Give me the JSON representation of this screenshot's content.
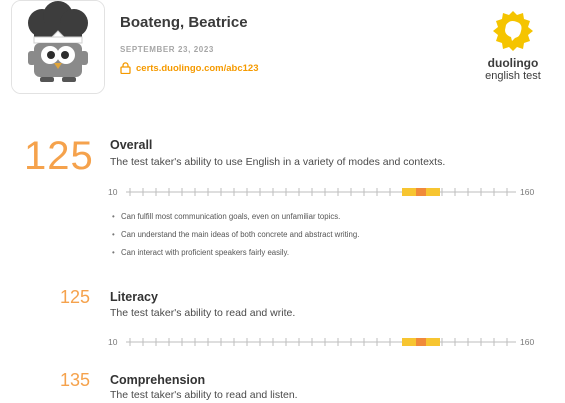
{
  "header": {
    "name": "Boateng, Beatrice",
    "date": "SEPTEMBER 23, 2023",
    "cert_link": "certs.duolingo.com/abc123",
    "brand_word": "duolingo",
    "brand_sub": "english test"
  },
  "overall": {
    "score": "125",
    "title": "Overall",
    "description": "The test taker's ability to use English in a variety of modes and contexts.",
    "scale_min": "10",
    "scale_max": "160",
    "bullets": [
      "Can fulfill most communication goals, even on unfamiliar topics.",
      "Can understand the main ideas of both concrete and abstract writing.",
      "Can interact with proficient speakers fairly easily."
    ]
  },
  "literacy": {
    "score": "125",
    "title": "Literacy",
    "description": "The test taker's ability to read and write.",
    "scale_min": "10",
    "scale_max": "160"
  },
  "comprehension": {
    "score": "135",
    "title": "Comprehension",
    "description": "The test taker's ability to read and listen."
  },
  "colors": {
    "accent": "#f5a24c",
    "band": "#f7c531",
    "marker": "#f08a3a"
  }
}
